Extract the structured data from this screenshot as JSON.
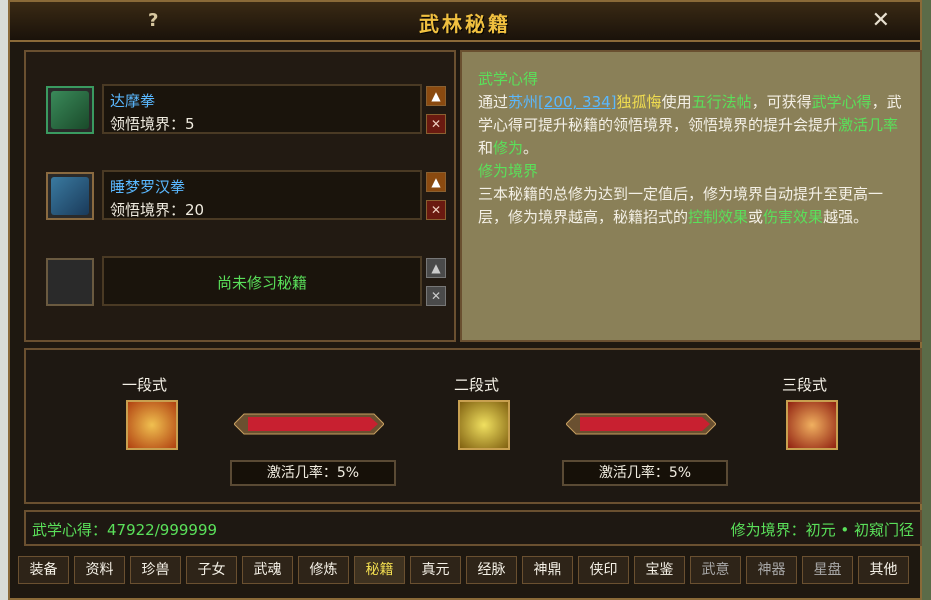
{
  "window": {
    "title": "武林秘籍",
    "help": "?",
    "close": "✕"
  },
  "books": [
    {
      "name": "达摩拳",
      "level": "领悟境界：5"
    },
    {
      "name": "睡梦罗汉拳",
      "level": "领悟境界：20"
    },
    {
      "empty_text": "尚未修习秘籍"
    }
  ],
  "buttons": {
    "up": "▲",
    "delete": "✕"
  },
  "description": {
    "h1": "武学心得",
    "p1a": "通过",
    "p1b": "苏州",
    "p1c": "[200, 334]",
    "p1d": "独孤悔",
    "p1e": "使用",
    "p1f": "五行法帖",
    "p1g": "，可获得",
    "p1h": "武学心得",
    "p1i": "，武学心得可提升秘籍的领悟境界，领悟境界的提升会提升",
    "p1j": "激活几率",
    "p1k": "和",
    "p1l": "修为",
    "p1m": "。",
    "h2": "修为境界",
    "p2a": "三本秘籍的总修为达到一定值后，修为境界自动提升至更高一层，修为境界越高，秘籍招式的",
    "p2b": "控制效果",
    "p2c": "或",
    "p2d": "伤害效果",
    "p2e": "越强。"
  },
  "stages": [
    {
      "label": "一段式"
    },
    {
      "label": "二段式"
    },
    {
      "label": "三段式"
    }
  ],
  "rates": [
    "激活几率：5%",
    "激活几率：5%"
  ],
  "status": {
    "left": "武学心得：47922/999999",
    "right": "修为境界：初元 • 初窥门径"
  },
  "tabs": [
    "装备",
    "资料",
    "珍兽",
    "子女",
    "武魂",
    "修炼",
    "秘籍",
    "真元",
    "经脉",
    "神鼎",
    "侠印",
    "宝鉴",
    "武意",
    "神器",
    "星盘",
    "其他"
  ],
  "colors": {
    "green": "#5ae05a",
    "yellow": "#f0dc50",
    "blue": "#5ab8ff",
    "gold": "#f0c040"
  }
}
